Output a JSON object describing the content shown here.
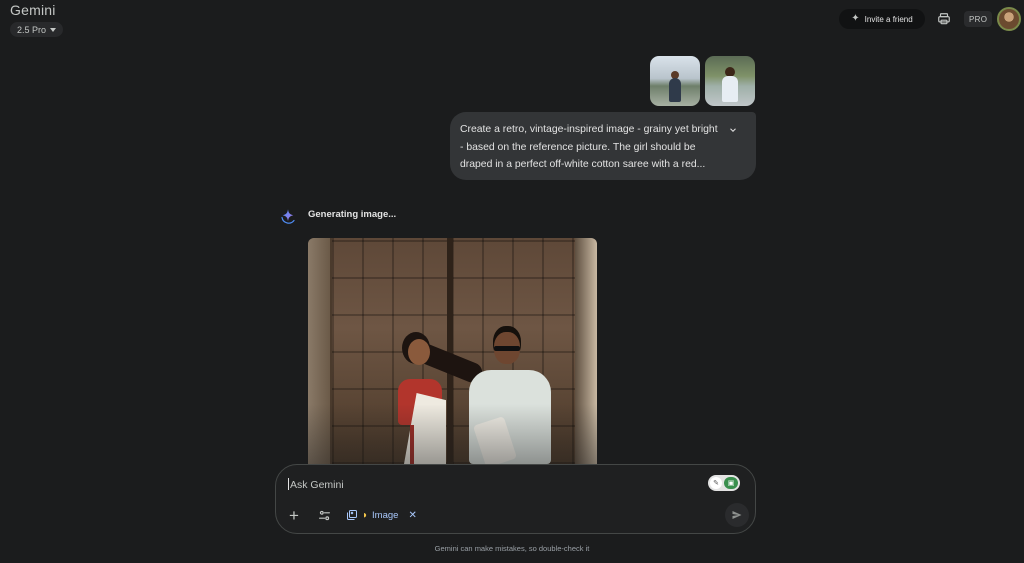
{
  "app": {
    "title": "Gemini",
    "model": "2.5 Pro"
  },
  "header": {
    "invite_label": "Invite a friend",
    "pro_badge": "PRO"
  },
  "user_message": {
    "text": "Create a retro, vintage-inspired image - grainy yet bright - based on the reference picture. The girl should be draped in a perfect off-white cotton saree with a red...",
    "attachments": 2
  },
  "response": {
    "status": "Generating image..."
  },
  "input": {
    "placeholder": "Ask Gemini",
    "active_tool": "Image"
  },
  "footer": {
    "disclaimer": "Gemini can make mistakes, so double-check it"
  },
  "icons": {
    "invite": "sparkle-icon",
    "printer": "printer-icon",
    "expand": "chevron-down-icon",
    "assistant": "gemini-spark-icon",
    "add": "plus-icon",
    "tools": "tools-sliders-icon",
    "image_tool": "image-icon",
    "banana": "banana-icon",
    "remove": "close-icon",
    "send": "send-icon"
  },
  "colors": {
    "background": "#1b1c1d",
    "bubble": "#333537",
    "accent": "#a8c7fa"
  }
}
